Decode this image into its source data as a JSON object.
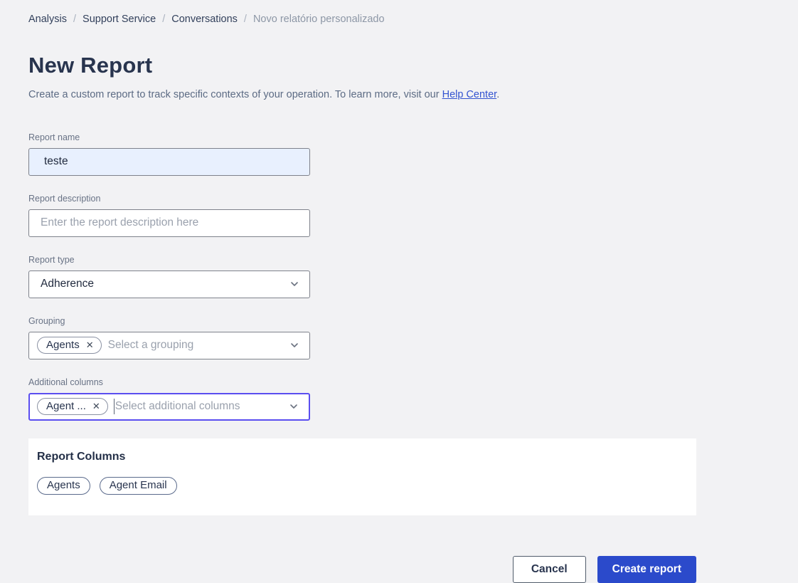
{
  "breadcrumb": {
    "separator": "/",
    "items": [
      {
        "label": "Analysis"
      },
      {
        "label": "Support Service"
      },
      {
        "label": "Conversations"
      },
      {
        "label": "Novo relatório personalizado"
      }
    ]
  },
  "header": {
    "title": "New Report",
    "subtitle_prefix": "Create a custom report to track specific contexts of your operation. To learn more, visit our ",
    "subtitle_link": "Help Center",
    "subtitle_suffix": "."
  },
  "form": {
    "report_name": {
      "label": "Report name",
      "value": "teste"
    },
    "report_description": {
      "label": "Report description",
      "placeholder": "Enter the report description here"
    },
    "report_type": {
      "label": "Report type",
      "value": "Adherence"
    },
    "grouping": {
      "label": "Grouping",
      "chip": "Agents",
      "placeholder": "Select a grouping"
    },
    "additional_columns": {
      "label": "Additional columns",
      "chip": "Agent ...",
      "placeholder": "Select additional columns"
    }
  },
  "report_columns": {
    "title": "Report Columns",
    "pills": [
      "Agents",
      "Agent Email"
    ]
  },
  "actions": {
    "cancel": "Cancel",
    "create": "Create report"
  },
  "icons": {
    "close": "✕"
  },
  "colors": {
    "page_background": "#f2f2f4",
    "primary_blue": "#2b4acb",
    "focus_indigo": "#5b4ef0",
    "autofill_background": "#e8f0fe",
    "link_blue": "#3353d0",
    "heading_navy": "#28344e"
  }
}
